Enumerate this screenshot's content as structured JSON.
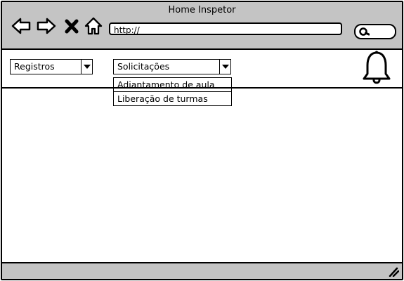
{
  "window": {
    "title": "Home Inspetor",
    "url": "http://"
  },
  "icons": {
    "back": "arrow-left-icon",
    "forward": "arrow-right-icon",
    "close": "x-icon",
    "home": "home-icon",
    "search": "search-icon",
    "notifications": "bell-icon",
    "resize": "resize-grip-icon"
  },
  "toolbar": {
    "registros": {
      "value": "Registros"
    },
    "solicitacoes": {
      "value": "Solicitações",
      "options": [
        "Adiantamento de aula",
        "Liberação de turmas"
      ]
    }
  },
  "colors": {
    "chrome": "#c4c4c4",
    "border": "#000000",
    "background": "#ffffff"
  }
}
